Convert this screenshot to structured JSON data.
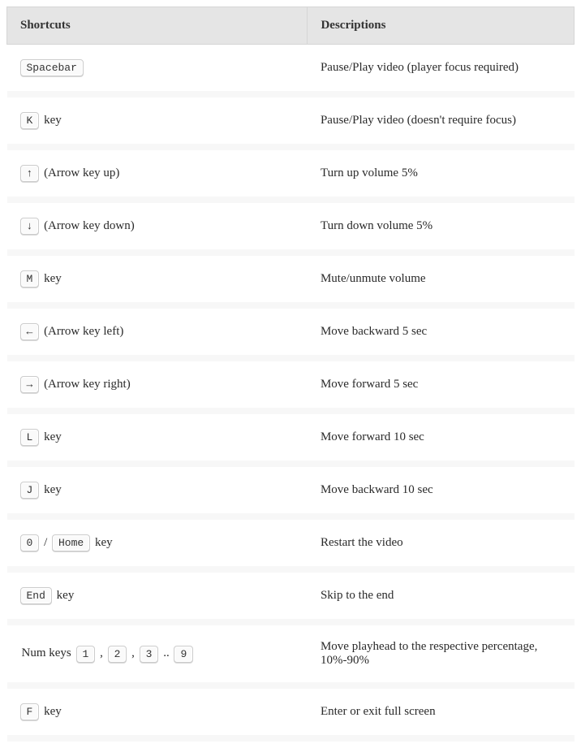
{
  "table": {
    "header": {
      "shortcuts": "Shortcuts",
      "descriptions": "Descriptions"
    },
    "rows": [
      {
        "shortcut": [
          {
            "type": "kbd",
            "text": "Spacebar"
          }
        ],
        "description": "Pause/Play video (player focus required)"
      },
      {
        "shortcut": [
          {
            "type": "kbd",
            "text": "K"
          },
          {
            "type": "text",
            "text": " key"
          }
        ],
        "description": "Pause/Play video (doesn't require focus)"
      },
      {
        "shortcut": [
          {
            "type": "kbd",
            "text": "↑"
          },
          {
            "type": "text",
            "text": " (Arrow key up)"
          }
        ],
        "description": "Turn up volume 5%"
      },
      {
        "shortcut": [
          {
            "type": "kbd",
            "text": "↓"
          },
          {
            "type": "text",
            "text": " (Arrow key down)"
          }
        ],
        "description": "Turn down volume 5%"
      },
      {
        "shortcut": [
          {
            "type": "kbd",
            "text": "M"
          },
          {
            "type": "text",
            "text": " key"
          }
        ],
        "description": "Mute/unmute volume"
      },
      {
        "shortcut": [
          {
            "type": "kbd",
            "text": "←"
          },
          {
            "type": "text",
            "text": " (Arrow key left)"
          }
        ],
        "description": "Move backward 5 sec"
      },
      {
        "shortcut": [
          {
            "type": "kbd",
            "text": "→"
          },
          {
            "type": "text",
            "text": " (Arrow key right)"
          }
        ],
        "description": "Move forward 5 sec"
      },
      {
        "shortcut": [
          {
            "type": "kbd",
            "text": "L"
          },
          {
            "type": "text",
            "text": " key"
          }
        ],
        "description": "Move forward 10 sec"
      },
      {
        "shortcut": [
          {
            "type": "kbd",
            "text": "J"
          },
          {
            "type": "text",
            "text": " key"
          }
        ],
        "description": "Move backward 10 sec"
      },
      {
        "shortcut": [
          {
            "type": "kbd",
            "text": "0"
          },
          {
            "type": "text",
            "text": " / "
          },
          {
            "type": "kbd",
            "text": "Home"
          },
          {
            "type": "text",
            "text": " key"
          }
        ],
        "description": "Restart the video"
      },
      {
        "shortcut": [
          {
            "type": "kbd",
            "text": "End"
          },
          {
            "type": "text",
            "text": " key"
          }
        ],
        "description": "Skip to the end"
      },
      {
        "shortcut": [
          {
            "type": "text",
            "text": "Num keys "
          },
          {
            "type": "kbd",
            "text": "1"
          },
          {
            "type": "text",
            "text": " , "
          },
          {
            "type": "kbd",
            "text": "2"
          },
          {
            "type": "text",
            "text": " , "
          },
          {
            "type": "kbd",
            "text": "3"
          },
          {
            "type": "text",
            "text": " .. "
          },
          {
            "type": "kbd",
            "text": "9"
          }
        ],
        "description": "Move playhead to the respective percentage, 10%-90%"
      },
      {
        "shortcut": [
          {
            "type": "kbd",
            "text": "F"
          },
          {
            "type": "text",
            "text": " key"
          }
        ],
        "description": "Enter or exit full screen"
      }
    ]
  }
}
